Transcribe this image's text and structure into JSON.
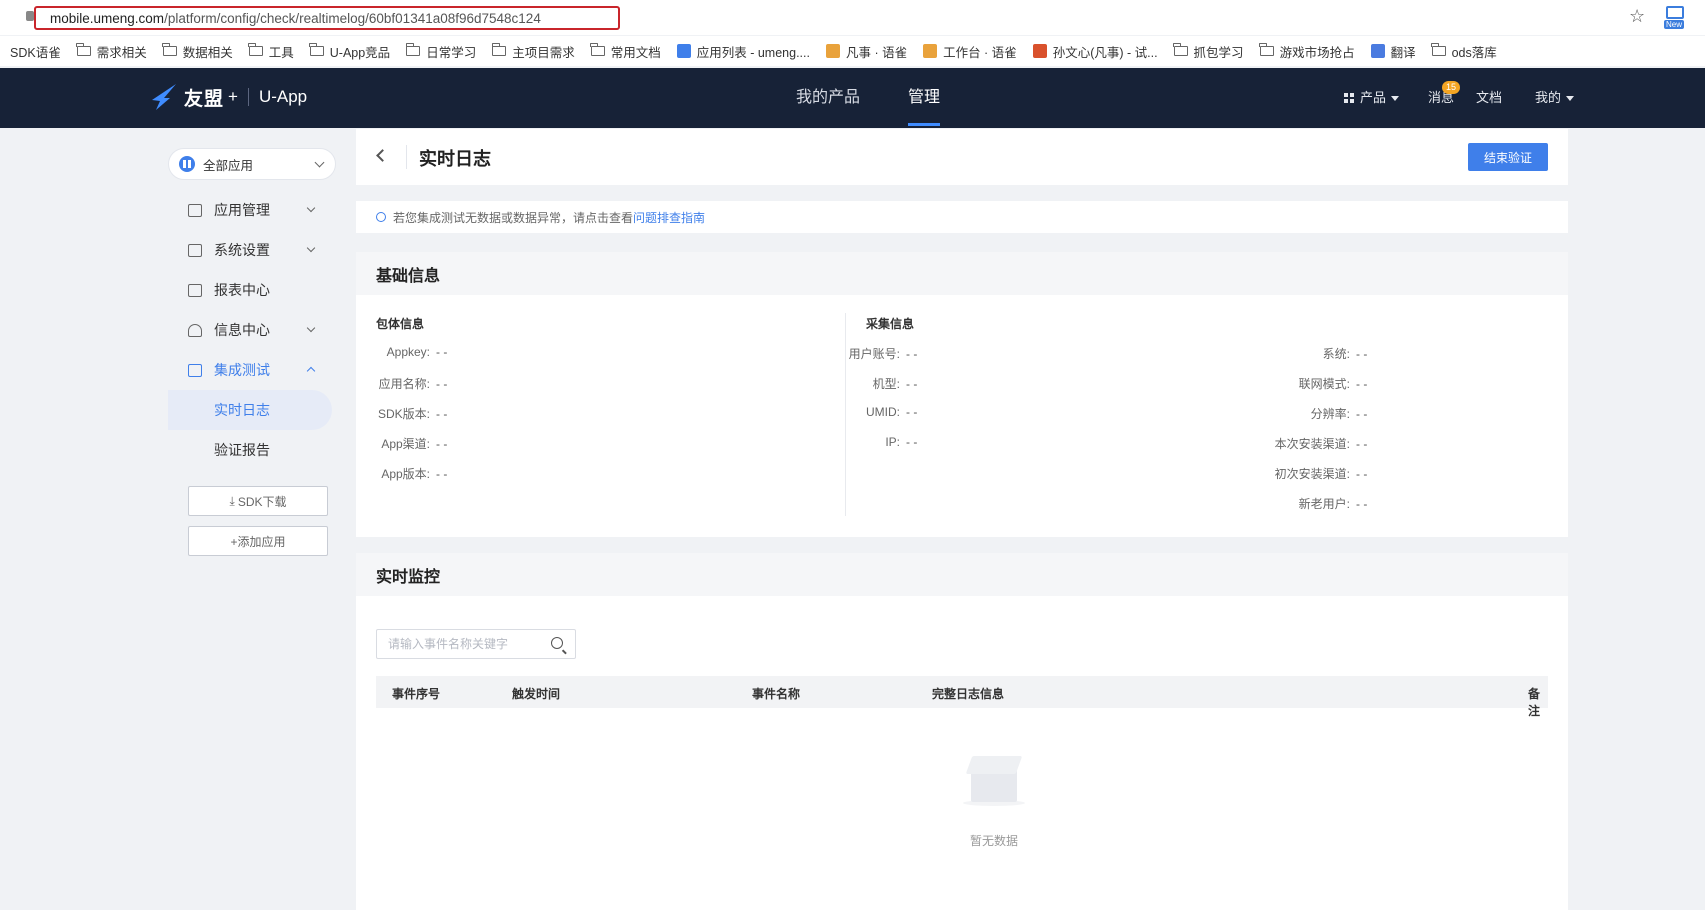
{
  "browser": {
    "url_host": "mobile.umeng.com",
    "url_path": "/platform/config/check/realtimelog/60bf01341a08f96d7548c124",
    "new_badge": "New"
  },
  "bookmarks": [
    {
      "label": "SDK语雀",
      "icon": "none"
    },
    {
      "label": "需求相关",
      "icon": "folder"
    },
    {
      "label": "数据相关",
      "icon": "folder"
    },
    {
      "label": "工具",
      "icon": "folder"
    },
    {
      "label": "U-App竞品",
      "icon": "folder"
    },
    {
      "label": "日常学习",
      "icon": "folder"
    },
    {
      "label": "主项目需求",
      "icon": "folder"
    },
    {
      "label": "常用文档",
      "icon": "folder"
    },
    {
      "label": "应用列表 - umeng....",
      "icon": "umeng"
    },
    {
      "label": "凡事 · 语雀",
      "icon": "yuque"
    },
    {
      "label": "工作台 · 语雀",
      "icon": "yuque"
    },
    {
      "label": "孙文心(凡事) - 试...",
      "icon": "red"
    },
    {
      "label": "抓包学习",
      "icon": "folder"
    },
    {
      "label": "游戏市场抢占",
      "icon": "folder"
    },
    {
      "label": "翻译",
      "icon": "translate"
    },
    {
      "label": "ods落库",
      "icon": "folder"
    }
  ],
  "topnav": {
    "brand": "友盟",
    "plus": "+",
    "product": "U-App",
    "tabs": [
      {
        "label": "我的产品",
        "active": false
      },
      {
        "label": "管理",
        "active": true
      }
    ],
    "products_label": "产品",
    "messages_label": "消息",
    "messages_count": "15",
    "docs_label": "文档",
    "mine_label": "我的"
  },
  "sidebar": {
    "app_select": "全部应用",
    "items": [
      {
        "label": "应用管理",
        "expandable": true
      },
      {
        "label": "系统设置",
        "expandable": true
      },
      {
        "label": "报表中心",
        "expandable": false
      },
      {
        "label": "信息中心",
        "expandable": true
      },
      {
        "label": "集成测试",
        "expandable": true,
        "open": true
      }
    ],
    "subitems": [
      {
        "label": "实时日志",
        "active": true
      },
      {
        "label": "验证报告",
        "active": false
      }
    ],
    "sdk_download": "SDK下载",
    "add_app": "+添加应用"
  },
  "page": {
    "title": "实时日志",
    "end_button": "结束验证",
    "tip_text": "若您集成测试无数据或数据异常，请点击查看",
    "tip_link": "问题排查指南"
  },
  "basic_info": {
    "title": "基础信息",
    "package_title": "包体信息",
    "package_fields": [
      {
        "key": "Appkey:",
        "value": "- -"
      },
      {
        "key": "应用名称:",
        "value": "- -"
      },
      {
        "key": "SDK版本:",
        "value": "- -"
      },
      {
        "key": "App渠道:",
        "value": "- -"
      },
      {
        "key": "App版本:",
        "value": "- -"
      }
    ],
    "collect_title": "采集信息",
    "collect_fields_left": [
      {
        "key": "用户账号:",
        "value": "- -"
      },
      {
        "key": "机型:",
        "value": "- -"
      },
      {
        "key": "UMID:",
        "value": "- -"
      },
      {
        "key": "IP:",
        "value": "- -"
      }
    ],
    "collect_fields_right": [
      {
        "key": "系统:",
        "value": "- -"
      },
      {
        "key": "联网模式:",
        "value": "- -"
      },
      {
        "key": "分辨率:",
        "value": "- -"
      },
      {
        "key": "本次安装渠道:",
        "value": "- -"
      },
      {
        "key": "初次安装渠道:",
        "value": "- -"
      },
      {
        "key": "新老用户:",
        "value": "- -"
      }
    ]
  },
  "monitor": {
    "title": "实时监控",
    "search_placeholder": "请输入事件名称关键字",
    "columns": [
      "事件序号",
      "触发时间",
      "事件名称",
      "完整日志信息",
      "备注"
    ],
    "empty_text": "暂无数据"
  },
  "colors": {
    "nav_bg": "#172237",
    "accent": "#3f7fea",
    "url_highlight": "#c9252b",
    "badge": "#f5a623"
  }
}
